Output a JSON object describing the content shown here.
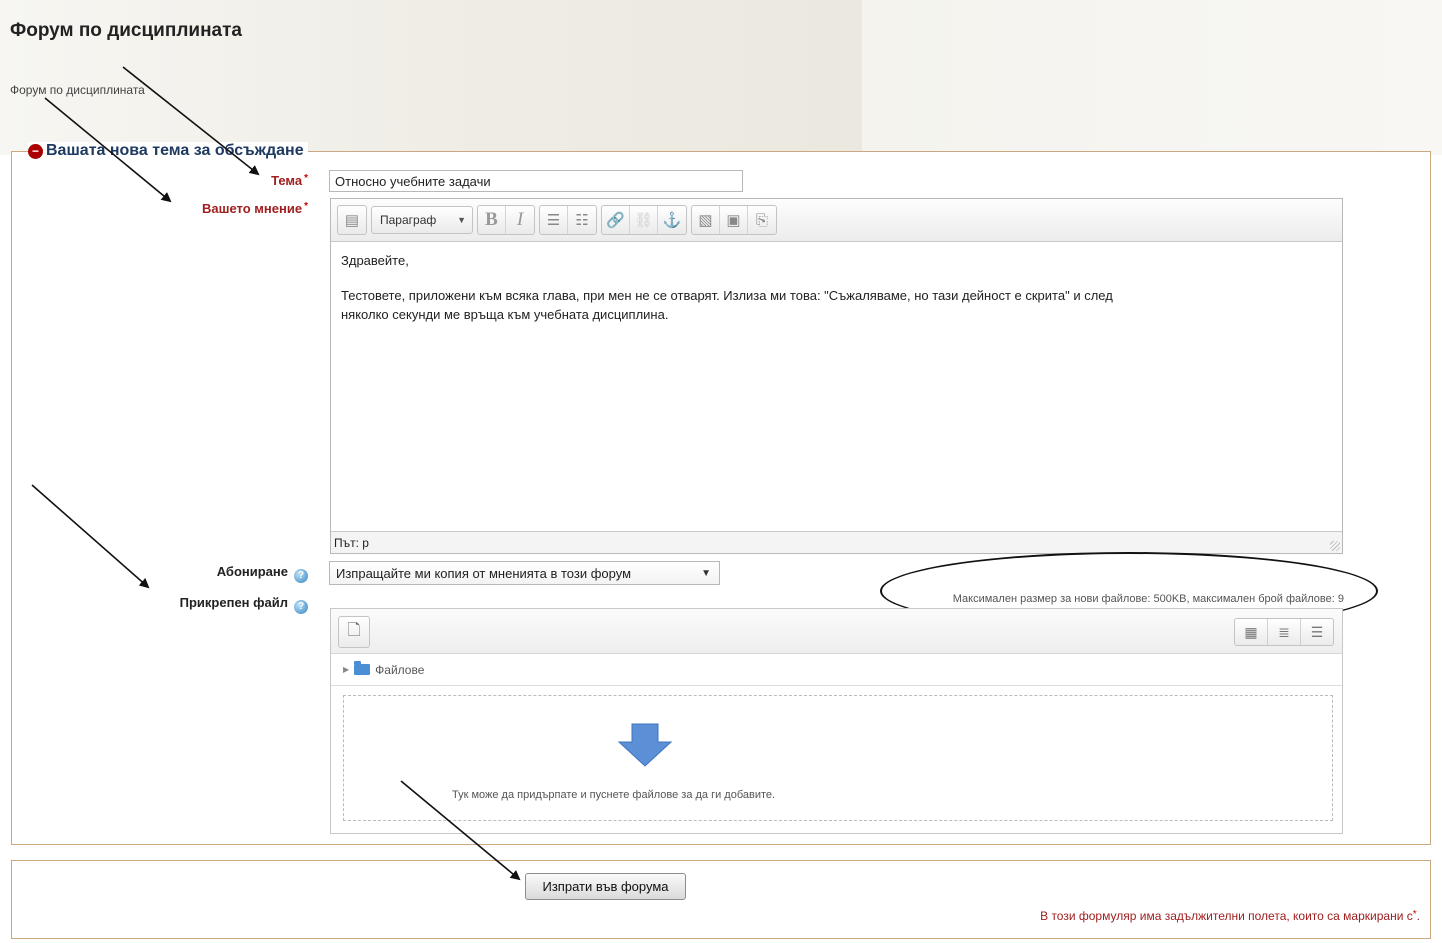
{
  "page": {
    "title": "Форум по дисциплината",
    "description": "Форум по дисциплината"
  },
  "form": {
    "legend": "Вашата нова тема за обсъждане",
    "subject": {
      "label": "Тема",
      "value": "Относно учебните задачи"
    },
    "message": {
      "label": "Вашето мнение",
      "format_select": "Параграф",
      "content_line1": "Здравейте,",
      "content_line2": "Тестовете, приложени към всяка глава, при мен не се отварят. Излиза ми това: \"Съжаляваме, но тази дейност е скрита\" и след няколко секунди ме връща към учебната дисциплина.",
      "status_path": "Път: p"
    },
    "subscription": {
      "label": "Абониране",
      "selected": "Изпращайте ми копия от мненията в този форум"
    },
    "attachment": {
      "label": "Прикрепен файл",
      "max_info": "Максимален размер за нови файлове: 500KB, максимален брой файлове: 9",
      "folder": "Файлове",
      "drop_hint": "Тук може да придърпате и пуснете файлове за да ги добавите."
    },
    "submit_label": "Изпрати във форума",
    "required_note": "В този формуляр има задължителни полета, които са маркирани с",
    "required_note_end": "."
  },
  "icons": {
    "help": "help-icon",
    "collapse": "collapse-icon",
    "folder": "folder-icon",
    "add_file": "add-file-icon",
    "drop_arrow": "arrow-down-icon"
  },
  "colors": {
    "required_red": "#a02020",
    "legend_blue": "#1f3a60",
    "fieldset_border": "#c9a882",
    "drop_arrow": "#5b8fd6"
  }
}
